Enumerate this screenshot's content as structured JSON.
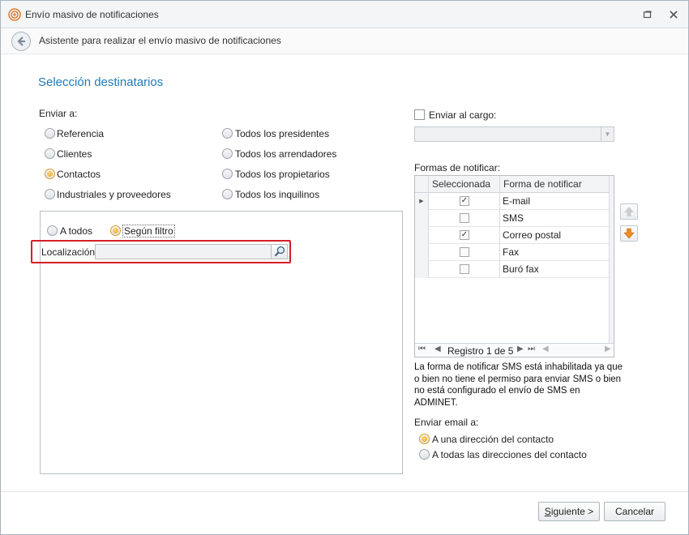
{
  "window": {
    "title": "Envío masivo de notificaciones"
  },
  "header": {
    "text": "Asistente para realizar el envío masivo de notificaciones"
  },
  "section": {
    "title": "Selección destinatarios"
  },
  "enviar_a": {
    "label": "Enviar a:",
    "options": [
      "Referencia",
      "Clientes",
      "Contactos",
      "Industriales y proveedores",
      "Todos los presidentes",
      "Todos los arrendadores",
      "Todos los propietarios",
      "Todos los inquilinos"
    ],
    "selected": "Contactos"
  },
  "filter": {
    "option_all": "A todos",
    "option_filter": "Según filtro",
    "selected": "Según filtro",
    "location_label": "Localización:",
    "location_value": ""
  },
  "cargo": {
    "checkbox_label": "Enviar al cargo:",
    "checked": false,
    "value": ""
  },
  "notify": {
    "label": "Formas de notificar:",
    "columns": [
      "Seleccionada",
      "Forma de notificar"
    ],
    "rows": [
      {
        "selected": true,
        "name": "E-mail"
      },
      {
        "selected": false,
        "name": "SMS"
      },
      {
        "selected": true,
        "name": "Correo postal"
      },
      {
        "selected": false,
        "name": "Fax"
      },
      {
        "selected": false,
        "name": "Buró fax"
      }
    ],
    "record_text": "Registro 1 de 5",
    "sms_info": "La forma de notificar SMS está inhabilitada ya que o bien no tiene el permiso para enviar SMS o bien no está configurado el envío de SMS en ADMINET."
  },
  "email": {
    "label": "Enviar email a:",
    "options": [
      "A una dirección del contacto",
      "A todas las direcciones del contacto"
    ],
    "selected": "A una dirección del contacto"
  },
  "buttons": {
    "next_accel": "S",
    "next_rest": "iguiente >",
    "cancel": "Cancelar"
  },
  "icons": [
    "app-icon",
    "back-arrow-icon",
    "restore-icon",
    "close-icon",
    "search-icon",
    "move-up-icon",
    "move-down-icon",
    "row-pointer-icon",
    "first-record-icon",
    "prev-record-icon",
    "next-record-icon",
    "last-record-icon"
  ],
  "colors": {
    "accent": "#1f7bb6",
    "highlight": "#d51f26",
    "radio_on": "#f0a21f",
    "down_arrow": "#f08a24"
  }
}
